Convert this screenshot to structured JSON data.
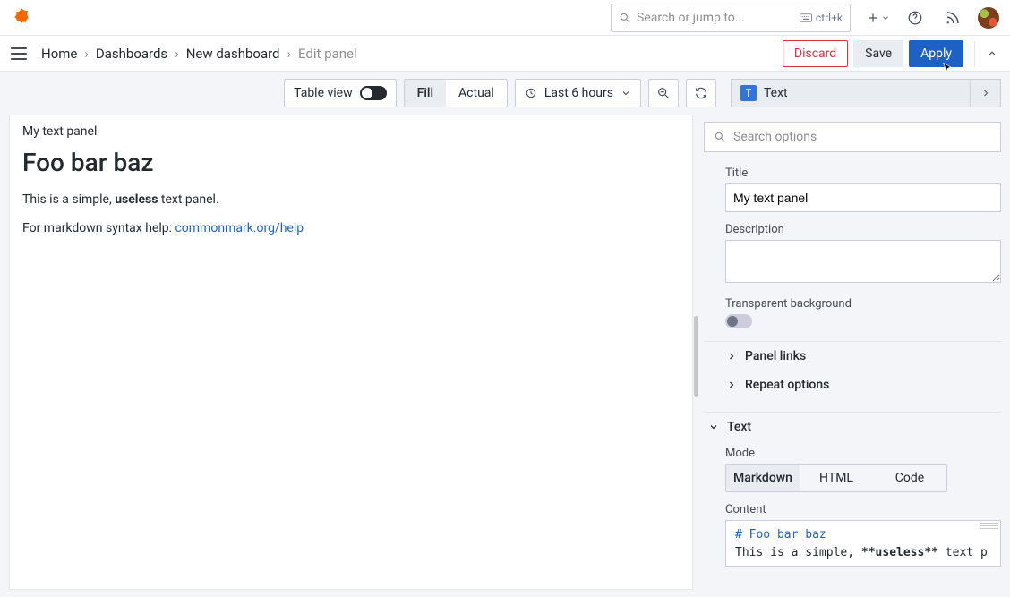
{
  "topbar": {
    "search_placeholder": "Search or jump to...",
    "kbd": "ctrl+k"
  },
  "crumbs": {
    "home": "Home",
    "dashboards": "Dashboards",
    "new_dashboard": "New dashboard",
    "edit_panel": "Edit panel"
  },
  "actions": {
    "discard": "Discard",
    "save": "Save",
    "apply": "Apply"
  },
  "toolbar": {
    "table_view": "Table view",
    "fill": "Fill",
    "actual": "Actual",
    "time_range": "Last 6 hours"
  },
  "viz": {
    "label": "Text"
  },
  "preview": {
    "panel_title": "My text panel",
    "heading": "Foo bar baz",
    "para1_pre": "This is a simple, ",
    "para1_bold": "useless",
    "para1_post": " text panel.",
    "para2_pre": "For markdown syntax help: ",
    "para2_link": "commonmark.org/help"
  },
  "options": {
    "search_placeholder": "Search options",
    "title_label": "Title",
    "title_value": "My text panel",
    "description_label": "Description",
    "transparent_label": "Transparent background",
    "panel_links": "Panel links",
    "repeat_options": "Repeat options",
    "text_section": "Text",
    "mode_label": "Mode",
    "mode_items": {
      "markdown": "Markdown",
      "html": "HTML",
      "code": "Code"
    },
    "content_label": "Content",
    "content_line1": "# Foo bar baz",
    "content_line2_a": "This is a simple, ",
    "content_line2_b": "**useless**",
    "content_line2_c": " text p"
  }
}
